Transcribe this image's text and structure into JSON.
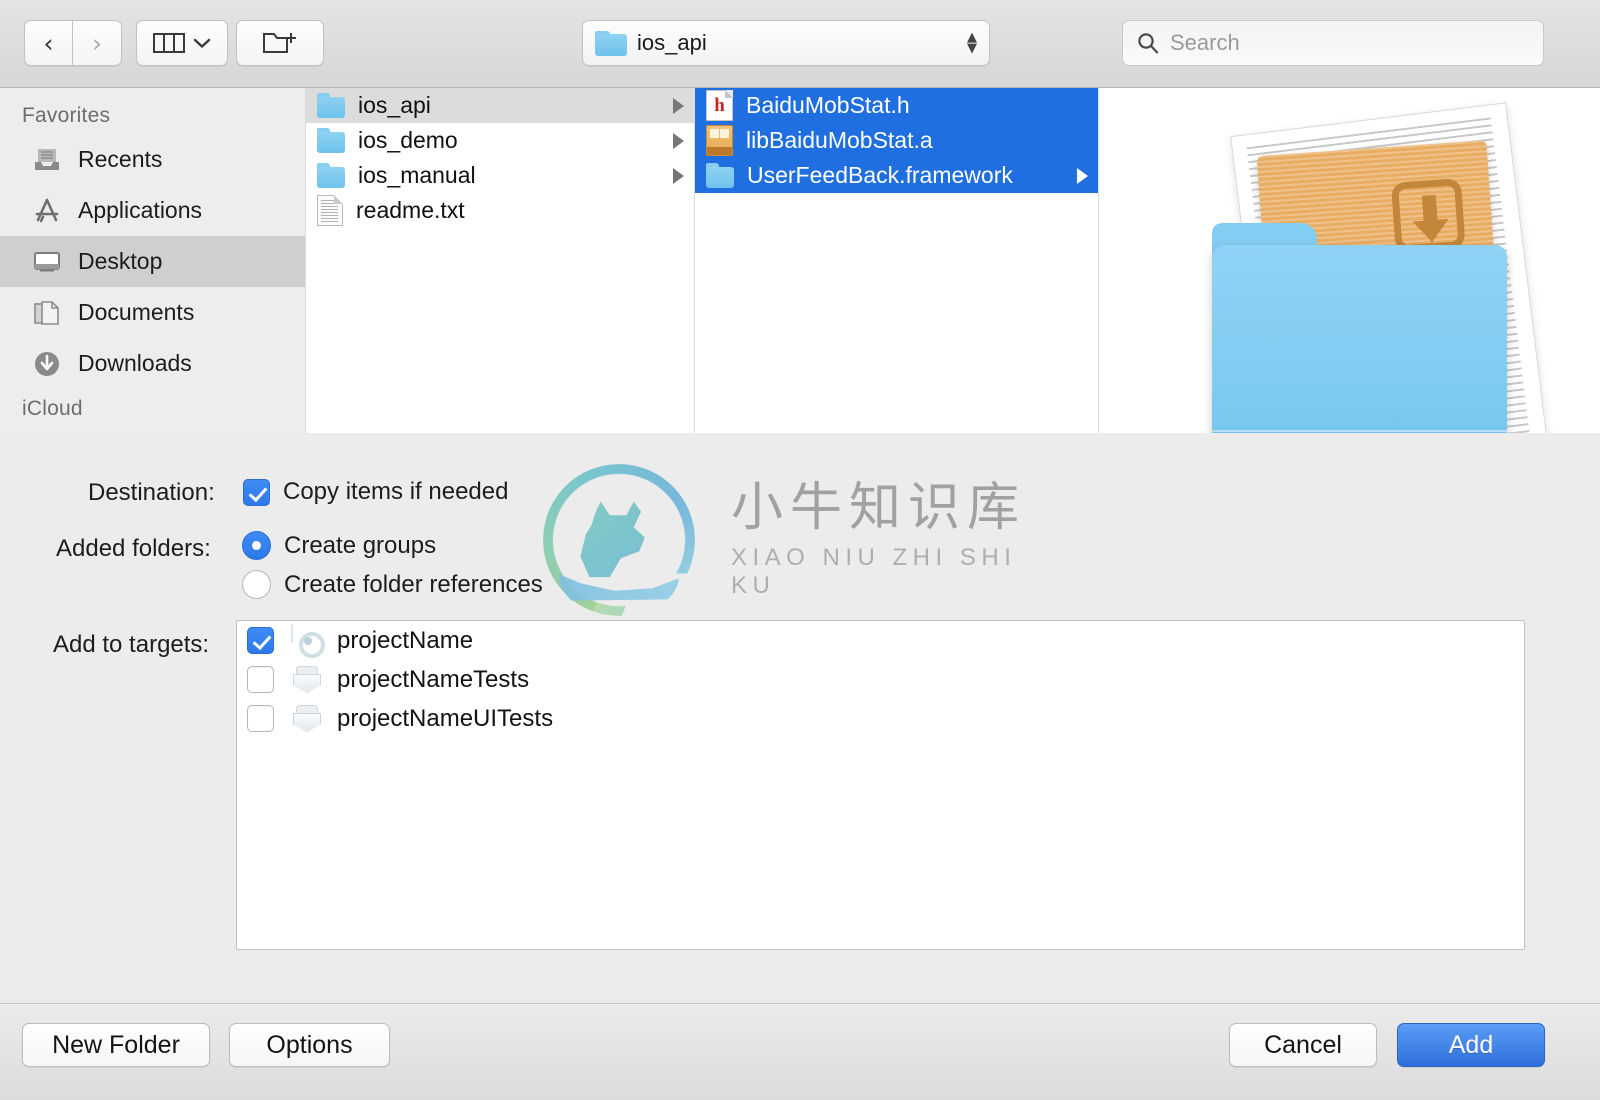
{
  "toolbar": {
    "back_icon": "chevron-left-icon",
    "forward_icon": "chevron-right-icon",
    "view_mode_icon": "column-view-icon",
    "view_mode_chevron": "chevron-down-icon",
    "new_folder_icon": "new-folder-icon",
    "path": {
      "label": "ios_api",
      "folder_icon": "folder-icon",
      "stepper_icon": "up-down-stepper-icon"
    },
    "search": {
      "placeholder": "Search",
      "value": "",
      "icon": "search-icon"
    }
  },
  "sidebar": {
    "section_title": "Favorites",
    "section_title_2": "iCloud",
    "items": [
      {
        "label": "Recents",
        "icon": "recents-icon",
        "selected": false
      },
      {
        "label": "Applications",
        "icon": "applications-icon",
        "selected": false
      },
      {
        "label": "Desktop",
        "icon": "desktop-icon",
        "selected": true
      },
      {
        "label": "Documents",
        "icon": "documents-icon",
        "selected": false
      },
      {
        "label": "Downloads",
        "icon": "downloads-icon",
        "selected": false
      }
    ]
  },
  "browser": {
    "column1": [
      {
        "name": "ios_api",
        "icon": "folder-icon",
        "state": "selected-inactive",
        "has_children": true
      },
      {
        "name": "ios_demo",
        "icon": "folder-icon",
        "state": "normal",
        "has_children": true
      },
      {
        "name": "ios_manual",
        "icon": "folder-icon",
        "state": "normal",
        "has_children": true
      },
      {
        "name": "readme.txt",
        "icon": "document-icon",
        "state": "normal",
        "has_children": false
      }
    ],
    "column2": [
      {
        "name": "BaiduMobStat.h",
        "icon": "header-file-icon",
        "state": "selected-active",
        "has_children": false
      },
      {
        "name": "libBaiduMobStat.a",
        "icon": "archive-file-icon",
        "state": "selected-active",
        "has_children": false
      },
      {
        "name": "UserFeedBack.framework",
        "icon": "folder-icon",
        "state": "selected-active",
        "has_children": true
      }
    ],
    "preview": {
      "icons": [
        "document-preview-icon",
        "archive-preview-icon",
        "folder-preview-icon"
      ]
    }
  },
  "accessory": {
    "destination": {
      "label": "Destination:",
      "checkbox_label": "Copy items if needed",
      "checked": true
    },
    "added_folders": {
      "label": "Added folders:",
      "options": [
        {
          "label": "Create groups",
          "selected": true
        },
        {
          "label": "Create folder references",
          "selected": false
        }
      ]
    },
    "add_to_targets": {
      "label": "Add to targets:",
      "rows": [
        {
          "name": "projectName",
          "checked": true,
          "icon": "app-target-icon"
        },
        {
          "name": "projectNameTests",
          "checked": false,
          "icon": "test-target-icon"
        },
        {
          "name": "projectNameUITests",
          "checked": false,
          "icon": "test-target-icon"
        }
      ]
    }
  },
  "bottom_bar": {
    "new_folder": "New Folder",
    "options": "Options",
    "cancel": "Cancel",
    "add": "Add"
  },
  "watermark": {
    "chinese": "小牛知识库",
    "pinyin": "XIAO NIU ZHI SHI KU"
  },
  "colors": {
    "selection_blue": "#1f6fe0",
    "control_blue": "#2f6fdd",
    "panel_gray": "#ececec",
    "sidebar_gray": "#ededed",
    "folder_blue": "#7ccaf0"
  }
}
